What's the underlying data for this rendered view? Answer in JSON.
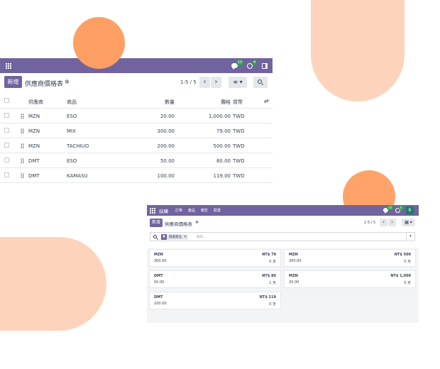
{
  "window1": {
    "navbar": {
      "messages_count": "10",
      "activity_count": "4"
    },
    "control": {
      "new_label": "新增",
      "title": "供應商價格表",
      "settings_icon": "gear-icon",
      "pager": "1-5 / 5",
      "prev": "‹",
      "next": "›",
      "view_switch": "≡ ▾"
    },
    "columns": {
      "vendor": "供應商",
      "product": "商品",
      "quantity": "數量",
      "price": "價格",
      "currency": "貨幣"
    },
    "rows": [
      {
        "vendor": "MZN",
        "product": "ESO",
        "quantity": "20.00",
        "price": "1,000.00",
        "currency": "TWD"
      },
      {
        "vendor": "MZN",
        "product": "MIX",
        "quantity": "300.00",
        "price": "79.00",
        "currency": "TWD"
      },
      {
        "vendor": "MZN",
        "product": "TACHIUO",
        "quantity": "200.00",
        "price": "500.00",
        "currency": "TWD"
      },
      {
        "vendor": "DMT",
        "product": "ESO",
        "quantity": "50.00",
        "price": "80.00",
        "currency": "TWD"
      },
      {
        "vendor": "DMT",
        "product": "KAMASU",
        "quantity": "100.00",
        "price": "119.00",
        "currency": "TWD"
      }
    ]
  },
  "window2": {
    "navbar": {
      "brand": "採購",
      "menu": [
        "訂單",
        "產品",
        "報告",
        "配置"
      ],
      "messages_count": "10",
      "activity_count": "4",
      "avatar": "R"
    },
    "control": {
      "new_label": "新增",
      "title": "供應商價格表",
      "pager": "1-5 / 5",
      "prev": "‹",
      "next": "›",
      "view_switch": "▦ ▾"
    },
    "search": {
      "facet": "篩選產品",
      "placeholder": "搜尋...",
      "remove": "✕",
      "dropdown": "▾"
    },
    "cards": [
      {
        "vendor": "MZN",
        "quantity": "300.00",
        "price": "NT$ 79",
        "delay": "0 天"
      },
      {
        "vendor": "MZN",
        "quantity": "200.00",
        "price": "NT$ 500",
        "delay": "0 天"
      },
      {
        "vendor": "DMT",
        "quantity": "50.00",
        "price": "NT$ 80",
        "delay": "1 天"
      },
      {
        "vendor": "MZN",
        "quantity": "20.00",
        "price": "NT$ 1,000",
        "delay": "0 天"
      },
      {
        "vendor": "DMT",
        "quantity": "100.00",
        "price": "NT$ 119",
        "delay": "0 天"
      }
    ]
  },
  "colors": {
    "brand": "#71639e",
    "accent_orange": "#ff9f64",
    "accent_peach": "#fdd4bb",
    "badge_green": "#28a745"
  }
}
